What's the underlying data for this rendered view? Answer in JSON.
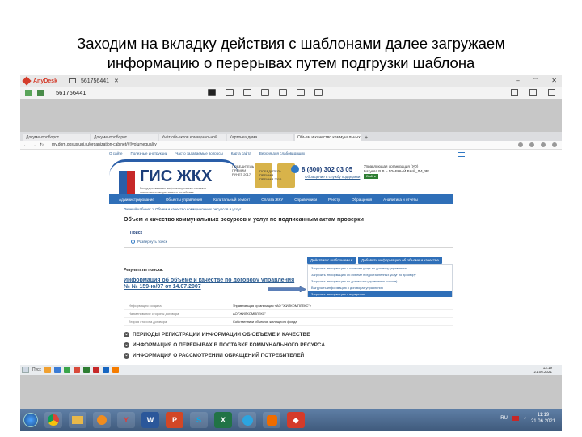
{
  "slide_title": "Заходим на вкладку действия с шаблонами далее загружаем информацию о перерывах путем подгрузки шаблона",
  "anydesk": {
    "app_name": "AnyDesk",
    "tab_address": "561756441",
    "address_field": "561756441",
    "win_controls": [
      "–",
      "▢",
      "✕"
    ]
  },
  "browser": {
    "tabs": [
      "Документооборот",
      "Документооборот",
      "Учёт объектов коммунальной...",
      "Карточка дома",
      "Объем и качество коммунальных..."
    ],
    "url": "my.dom.gosuslugi.ru/organization-cabinet/#!/volumequality"
  },
  "gis": {
    "top_links": [
      "О сайте",
      "Полезные инструкции",
      "Часто задаваемые вопросы",
      "Карта сайта",
      "Версия для слабовидящих"
    ],
    "logo_text": "ГИС ЖКХ",
    "logo_subtitle": "Государственная информационная система жилищно-коммунального хозяйства",
    "award1": "ПОБЕДИТЕЛЬ ПРЕМИИ РУНЕТ 2017",
    "award2": "ПОБЕДИТЕЛЬ ПРЕМИИ ПРЕМИЯ 2016",
    "phone": "8 (800) 302 03 05",
    "phone_link": "Обращение в службу поддержки",
    "user_line1": "Управляющая организация (УО)",
    "user_line2": "Батуева В.В. - ГЛАВНЫЙ ВЫЙ_ЛИ_ЯЕ",
    "logout": "Выйти",
    "nav": [
      "Администрирование",
      "Объекты управления",
      "Капитальный ремонт",
      "Оплата ЖКУ",
      "Справочники",
      "Реестр",
      "Обращения",
      "Аналитика и отчеты"
    ],
    "breadcrumb": "Личный кабинет  >  Объем и качество коммунальных ресурсов и услуг",
    "page_heading": "Объем и качество коммунальных ресурсов и услуг по подписанным актам проверки",
    "search_label": "Поиск",
    "search_link": "Развернуть поиск",
    "btn_templates": "Действия с шаблонами ▾",
    "btn_add": "Добавить информацию об объеме и качестве",
    "results_label": "Результаты поиска:",
    "result_title": "Информация об объеме и качестве по договору управления № № 159-ю/07 от 14.07.2007",
    "dropdown": [
      "Загрузить информацию о качестве услуг по договору управления",
      "Загрузить информацию об объеме предоставленных услуг по договору",
      "Загрузить информацию по договорам управления (состав)",
      "Выгрузить информацию о договорах управления",
      "Загрузить информацию о перерывах"
    ],
    "info": [
      {
        "k": "Информация создана",
        "v": "Управляющая организация «АО \"ЖИЛКОМПЛЕКС\"»"
      },
      {
        "k": "Наименование стороны договора",
        "v": "АО \"ЖИЛКОМПЛЕКС\""
      },
      {
        "k": "Вторая сторона договора",
        "v": "Собственники объектов жилищного фонда"
      }
    ],
    "sections": [
      "ПЕРИОДЫ РЕГИСТРАЦИИ ИНФОРМАЦИИ ОБ ОБЪЕМЕ И КАЧЕСТВЕ",
      "ИНФОРМАЦИЯ О ПЕРЕРЫВАХ В ПОСТАВКЕ КОММУНАЛЬНОГО РЕСУРСА",
      "ИНФОРМАЦИЯ О РАССМОТРЕНИИ ОБРАЩЕНИЙ ПОТРЕБИТЕЛЕЙ"
    ]
  },
  "remote_status": {
    "start": "Пуск",
    "clock": "13:19",
    "date": "21.06.2021"
  },
  "taskbar": {
    "lang": "RU",
    "time": "11:19",
    "date": "21.06.2021"
  },
  "colors": {
    "nav_blue": "#2f6fb8",
    "link_blue": "#2d5d91",
    "anydesk_red": "#d43b2a"
  }
}
